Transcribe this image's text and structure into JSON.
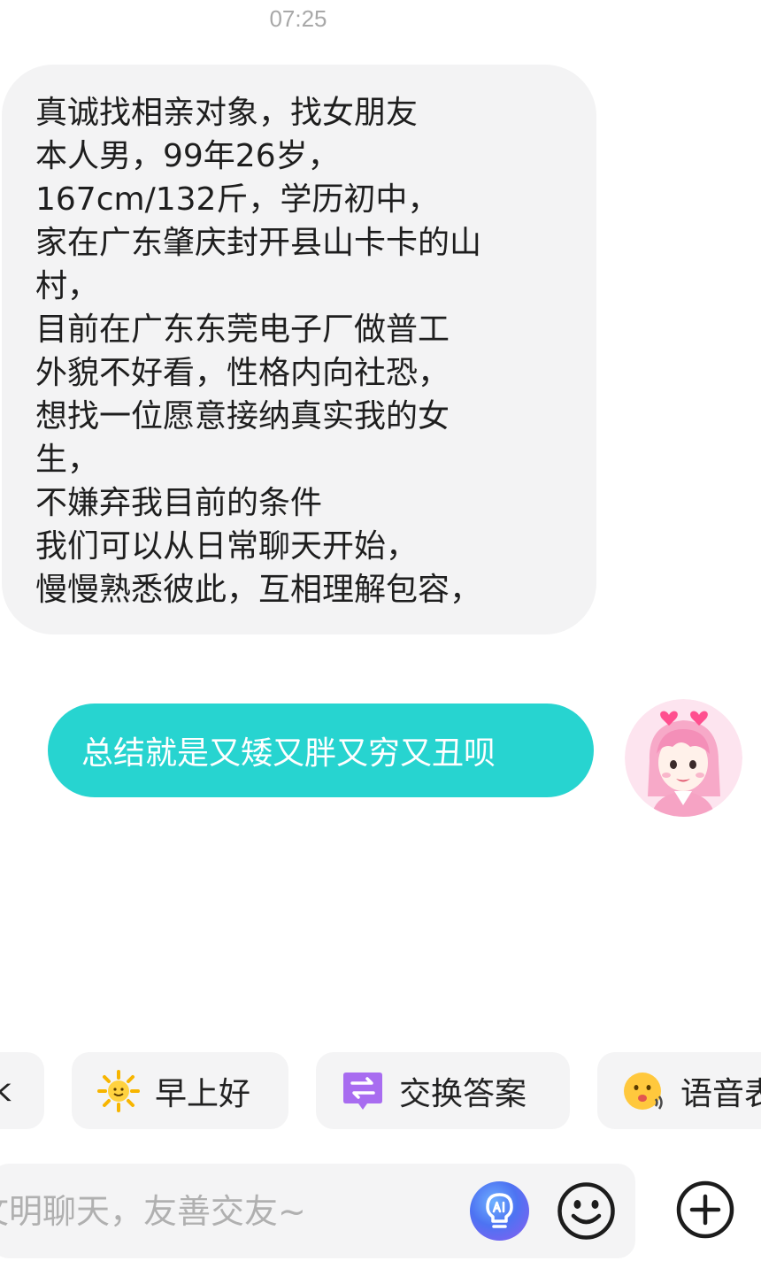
{
  "timestamp": "07:25",
  "incoming_message": {
    "lines": [
      "真诚找相亲对象，找女朋友",
      "本人男，99年26岁，",
      "167cm/132斤，学历初中，",
      "家在广东肇庆封开县山卡卡的山",
      "村，",
      "目前在广东东莞电子厂做普工",
      "外貌不好看，性格内向社恐，",
      "想找一位愿意接纳真实我的女",
      "生，",
      "不嫌弃我目前的条件",
      "我们可以从日常聊天开始，",
      "慢慢熟悉彼此，互相理解包容，"
    ]
  },
  "outgoing_message": {
    "text": "总结就是又矮又胖又穷又丑呗"
  },
  "quick_replies": [
    {
      "label": "k",
      "icon": "none"
    },
    {
      "label": "早上好",
      "icon": "sun-icon"
    },
    {
      "label": "交换答案",
      "icon": "exchange-icon"
    },
    {
      "label": "语音表",
      "icon": "voice-emoji-icon"
    }
  ],
  "input": {
    "placeholder": "文明聊天，友善交友~"
  },
  "colors": {
    "outgoing_bubble": "#27d4d0",
    "incoming_bubble": "#f3f3f4",
    "timestamp": "#a8a8a8"
  }
}
